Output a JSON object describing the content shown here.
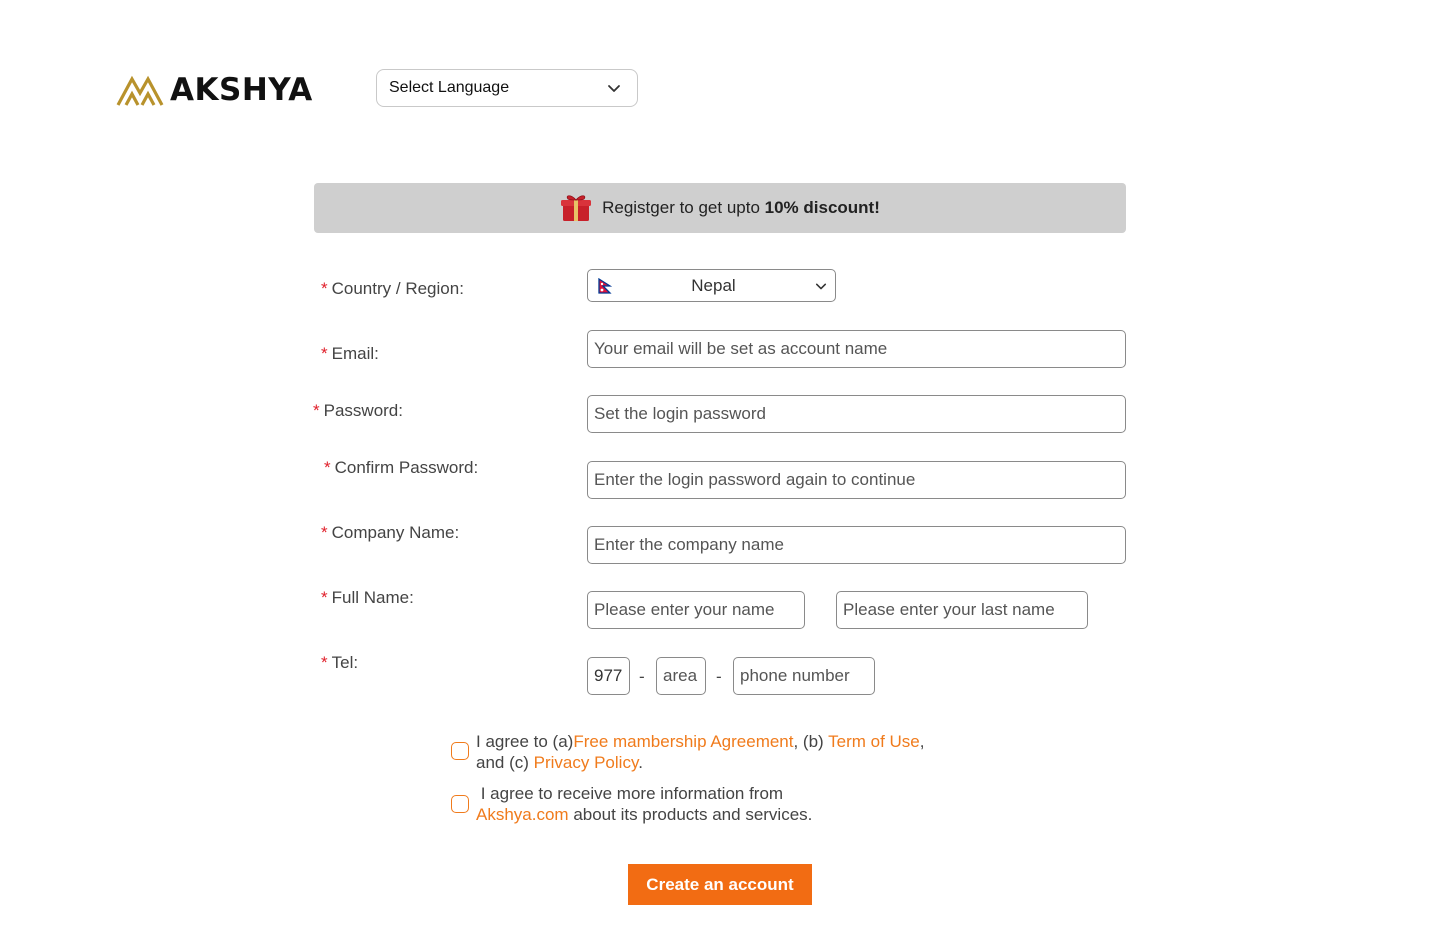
{
  "header": {
    "logo_text": "AKSHYA",
    "language_select": {
      "value": "Select Language",
      "icon": "chevron-down-icon"
    }
  },
  "banner": {
    "icon": "gift-icon",
    "text_prefix": "Registger to get upto ",
    "text_bold": "10% discount!"
  },
  "form": {
    "required_mark": "*",
    "country": {
      "label": "Country / Region:",
      "value": "Nepal",
      "flag_icon": "nepal-flag-icon"
    },
    "email": {
      "label": "Email:",
      "placeholder": "Your email will be set as account name"
    },
    "password": {
      "label": "Password:",
      "placeholder": "Set the login password"
    },
    "confirm_password": {
      "label": "Confirm Password:",
      "placeholder": "Enter the login password again to continue"
    },
    "company": {
      "label": "Company Name:",
      "placeholder": "Enter the company name"
    },
    "full_name": {
      "label": "Full Name:",
      "first_placeholder": "Please enter your name",
      "last_placeholder": "Please enter your last name"
    },
    "tel": {
      "label": "Tel:",
      "country_code": "977",
      "area_placeholder": "area",
      "phone_placeholder": "phone number",
      "separator": "-"
    }
  },
  "agreements": {
    "terms": {
      "t1": "I agree to (a)",
      "link1": "Free mambership Agreement",
      "t2": ", (b)  ",
      "link2": "Term of Use",
      "t3": ",",
      "t4": "and (c) ",
      "link3": "Privacy Policy",
      "t5": "."
    },
    "newsletter": {
      "t1": " I agree to receive more information from",
      "link": "Akshya.com",
      "t2": " about its products and services."
    }
  },
  "submit_label": "Create an account",
  "colors": {
    "accent": "#f26c13",
    "link": "#f07b1c",
    "required": "#e0202b",
    "banner_bg": "#cfcfcf",
    "logo_gold": "#b8922c"
  }
}
